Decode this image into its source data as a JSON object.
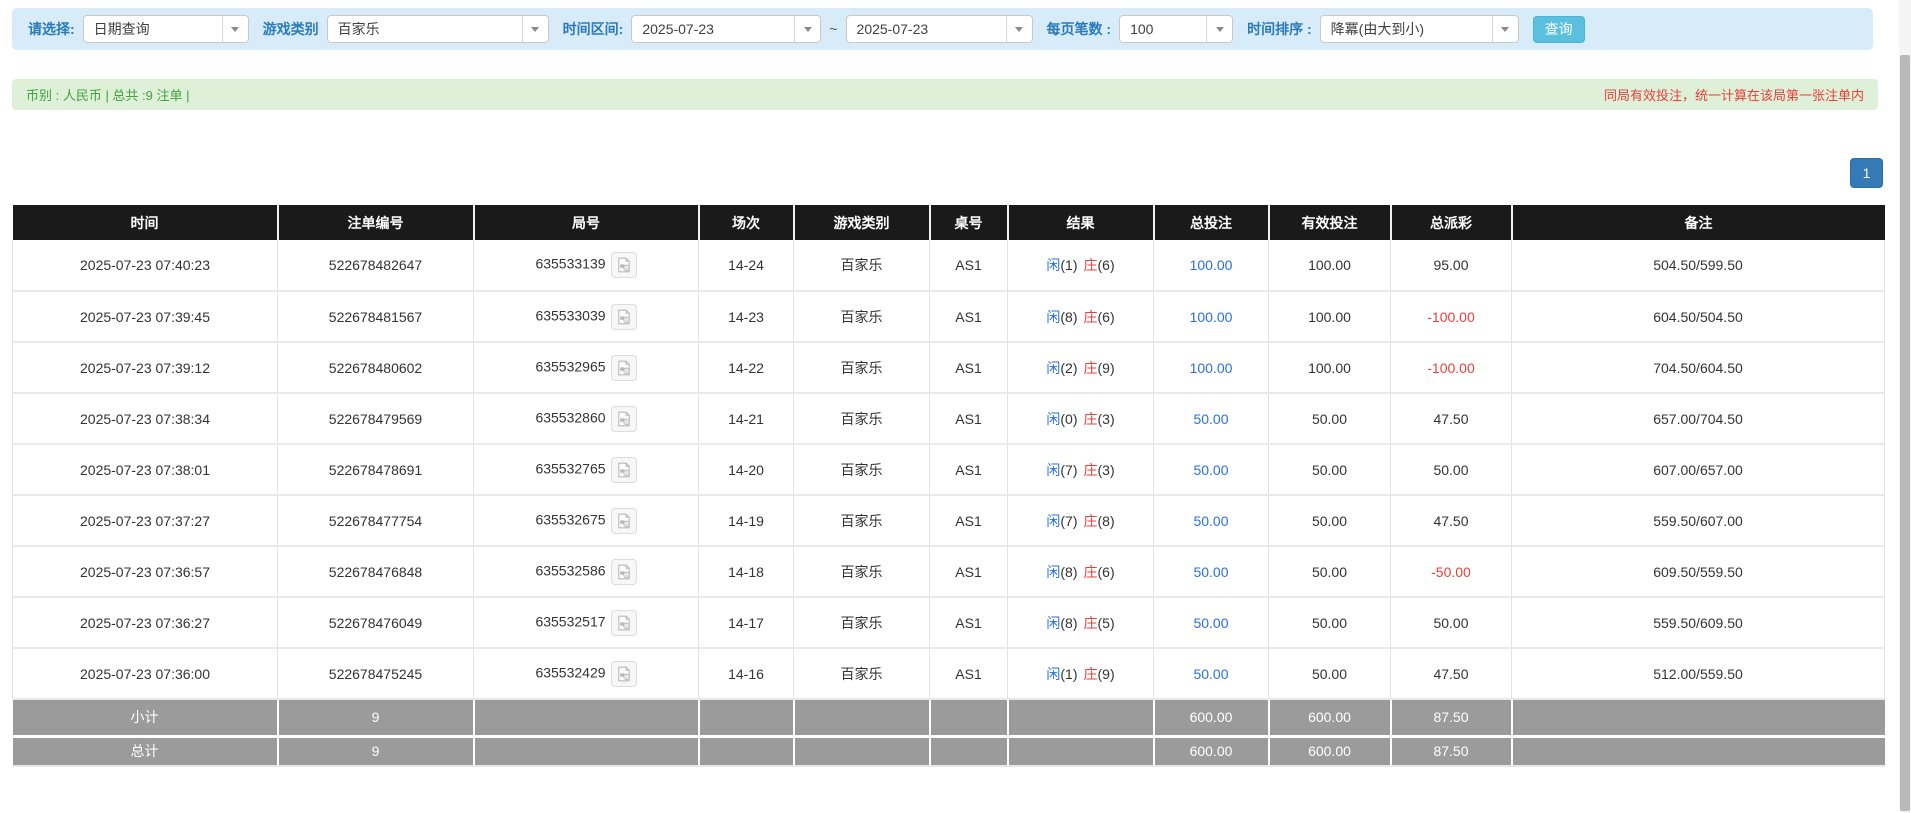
{
  "filters": {
    "select_label": "请选择:",
    "select_value": "日期查询",
    "game_type_label": "游戏类别",
    "game_type_value": "百家乐",
    "time_range_label": "时间区间:",
    "date_from": "2025-07-23",
    "range_separator": "~",
    "date_to": "2025-07-23",
    "page_size_label": "每页笔数 :",
    "page_size_value": "100",
    "sort_label": "时间排序 :",
    "sort_value": "降冪(由大到小)",
    "search_button": "查询"
  },
  "summary": {
    "left_text": "币别 : 人民币 | 总共 :9 注单 |",
    "right_text": "同局有效投注，统一计算在该局第一张注单内"
  },
  "pagination": {
    "pages": [
      "1"
    ]
  },
  "table": {
    "headers": [
      "时间",
      "注单编号",
      "局号",
      "场次",
      "游戏类别",
      "桌号",
      "结果",
      "总投注",
      "有效投注",
      "总派彩",
      "备注"
    ],
    "video_icon": "video-file-icon",
    "rows": [
      {
        "time": "2025-07-23 07:40:23",
        "bet_id": "522678482647",
        "round_id": "635533139",
        "session": "14-24",
        "game_type": "百家乐",
        "table_no": "AS1",
        "result": {
          "player_label": "闲",
          "player_num": "(1)",
          "banker_label": "庄",
          "banker_num": "(6)"
        },
        "total_bet": "100.00",
        "valid_bet": "100.00",
        "payout": "95.00",
        "remark": "504.50/599.50"
      },
      {
        "time": "2025-07-23 07:39:45",
        "bet_id": "522678481567",
        "round_id": "635533039",
        "session": "14-23",
        "game_type": "百家乐",
        "table_no": "AS1",
        "result": {
          "player_label": "闲",
          "player_num": "(8)",
          "banker_label": "庄",
          "banker_num": "(6)"
        },
        "total_bet": "100.00",
        "valid_bet": "100.00",
        "payout": "-100.00",
        "remark": "604.50/504.50"
      },
      {
        "time": "2025-07-23 07:39:12",
        "bet_id": "522678480602",
        "round_id": "635532965",
        "session": "14-22",
        "game_type": "百家乐",
        "table_no": "AS1",
        "result": {
          "player_label": "闲",
          "player_num": "(2)",
          "banker_label": "庄",
          "banker_num": "(9)"
        },
        "total_bet": "100.00",
        "valid_bet": "100.00",
        "payout": "-100.00",
        "remark": "704.50/604.50"
      },
      {
        "time": "2025-07-23 07:38:34",
        "bet_id": "522678479569",
        "round_id": "635532860",
        "session": "14-21",
        "game_type": "百家乐",
        "table_no": "AS1",
        "result": {
          "player_label": "闲",
          "player_num": "(0)",
          "banker_label": "庄",
          "banker_num": "(3)"
        },
        "total_bet": "50.00",
        "valid_bet": "50.00",
        "payout": "47.50",
        "remark": "657.00/704.50"
      },
      {
        "time": "2025-07-23 07:38:01",
        "bet_id": "522678478691",
        "round_id": "635532765",
        "session": "14-20",
        "game_type": "百家乐",
        "table_no": "AS1",
        "result": {
          "player_label": "闲",
          "player_num": "(7)",
          "banker_label": "庄",
          "banker_num": "(3)"
        },
        "total_bet": "50.00",
        "valid_bet": "50.00",
        "payout": "50.00",
        "remark": "607.00/657.00"
      },
      {
        "time": "2025-07-23 07:37:27",
        "bet_id": "522678477754",
        "round_id": "635532675",
        "session": "14-19",
        "game_type": "百家乐",
        "table_no": "AS1",
        "result": {
          "player_label": "闲",
          "player_num": "(7)",
          "banker_label": "庄",
          "banker_num": "(8)"
        },
        "total_bet": "50.00",
        "valid_bet": "50.00",
        "payout": "47.50",
        "remark": "559.50/607.00"
      },
      {
        "time": "2025-07-23 07:36:57",
        "bet_id": "522678476848",
        "round_id": "635532586",
        "session": "14-18",
        "game_type": "百家乐",
        "table_no": "AS1",
        "result": {
          "player_label": "闲",
          "player_num": "(8)",
          "banker_label": "庄",
          "banker_num": "(6)"
        },
        "total_bet": "50.00",
        "valid_bet": "50.00",
        "payout": "-50.00",
        "remark": "609.50/559.50"
      },
      {
        "time": "2025-07-23 07:36:27",
        "bet_id": "522678476049",
        "round_id": "635532517",
        "session": "14-17",
        "game_type": "百家乐",
        "table_no": "AS1",
        "result": {
          "player_label": "闲",
          "player_num": "(8)",
          "banker_label": "庄",
          "banker_num": "(5)"
        },
        "total_bet": "50.00",
        "valid_bet": "50.00",
        "payout": "50.00",
        "remark": "559.50/609.50"
      },
      {
        "time": "2025-07-23 07:36:00",
        "bet_id": "522678475245",
        "round_id": "635532429",
        "session": "14-16",
        "game_type": "百家乐",
        "table_no": "AS1",
        "result": {
          "player_label": "闲",
          "player_num": "(1)",
          "banker_label": "庄",
          "banker_num": "(9)"
        },
        "total_bet": "50.00",
        "valid_bet": "50.00",
        "payout": "47.50",
        "remark": "512.00/559.50"
      }
    ],
    "subtotal": {
      "label": "小计",
      "count": "9",
      "total_bet": "600.00",
      "valid_bet": "600.00",
      "payout": "87.50"
    },
    "grand_total": {
      "label": "总计",
      "count": "9",
      "total_bet": "600.00",
      "valid_bet": "600.00",
      "payout": "87.50"
    }
  },
  "colors": {
    "filter_bar_bg": "#d7ecf8",
    "filter_label_blue": "#2b7bb9",
    "search_button_bg": "#5bc0de",
    "summary_bar_bg": "#dff0d8",
    "summary_text_green": "#3fa33f",
    "notice_text_red": "#e8403a",
    "pagination_active_bg": "#337ab7",
    "table_header_bg": "#1a1a1a",
    "totals_row_bg": "#9b9b9b",
    "link_blue": "#2a6fe0",
    "player_blue": "#2a6fe0",
    "banker_red": "#e8403a",
    "negative_red": "#e8403a"
  }
}
